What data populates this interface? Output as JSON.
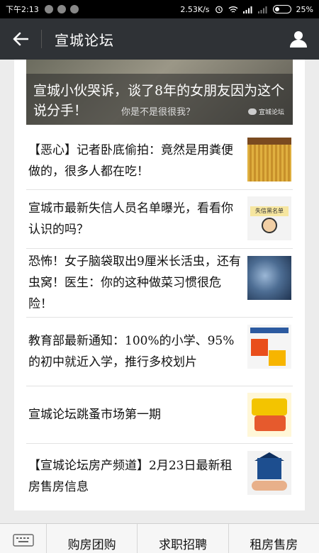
{
  "status_bar": {
    "time": "下午2:13",
    "network_speed": "2.53K/s",
    "battery": "25%"
  },
  "header": {
    "title": "宣城论坛",
    "back_icon": "arrow-left-icon",
    "profile_icon": "user-icon"
  },
  "hero": {
    "headline": "宣城小伙哭诉，谈了8年的女朋友因为这个说分手！",
    "caption": "你是不是很很我？",
    "watermark": "宣城论坛"
  },
  "articles": [
    {
      "title": "【恶心】记者卧底偷拍：竟然是用粪便做的，很多人都在吃！"
    },
    {
      "title": "宣城市最新失信人员名单曝光，看看你认识的吗？",
      "thumb_text": "失信黑名单"
    },
    {
      "title": "恐怖！女子脑袋取出9厘米长活虫，还有虫窝！医生：你的这种做菜习惯很危险！"
    },
    {
      "title": "教育部最新通知：100%的小学、95%的初中就近入学，推行多校划片"
    },
    {
      "title": "宣城论坛跳蚤市场第一期"
    },
    {
      "title": "【宣城论坛房产频道】2月23日最新租房售房信息"
    }
  ],
  "bottom_menu": {
    "keyboard_icon": "keyboard-icon",
    "items": [
      "购房团购",
      "求职招聘",
      "租房售房"
    ]
  },
  "colors": {
    "topbar": "#2f3236",
    "status": "#000000",
    "background": "#ececec"
  }
}
